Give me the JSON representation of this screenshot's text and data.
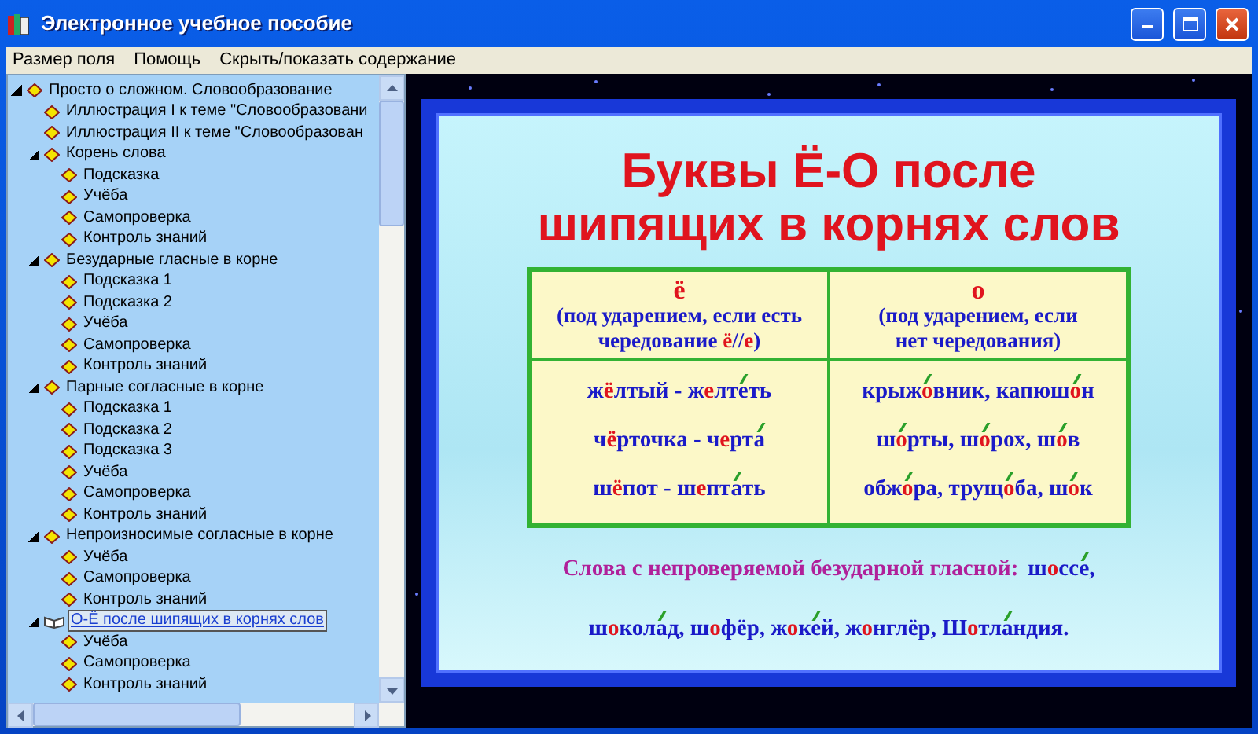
{
  "window": {
    "title": "Электронное учебное пособие"
  },
  "menu": [
    "Размер поля",
    "Помощь",
    "Скрыть/показать содержание"
  ],
  "tree": [
    {
      "label": "Просто о сложном. Словообразование",
      "expanded": true,
      "selected": false,
      "children": [
        {
          "label": "Иллюстрация I к теме \"Словообразовани",
          "selected": false
        },
        {
          "label": "Иллюстрация II к теме \"Словообразован",
          "selected": false
        },
        {
          "label": "Корень слова",
          "expanded": true,
          "selected": false,
          "children": [
            {
              "label": "Подсказка",
              "selected": false
            },
            {
              "label": "Учёба",
              "selected": false
            },
            {
              "label": "Самопроверка",
              "selected": false
            },
            {
              "label": "Контроль знаний",
              "selected": false
            }
          ]
        },
        {
          "label": "Безударные гласные в корне",
          "expanded": true,
          "selected": false,
          "children": [
            {
              "label": "Подсказка 1",
              "selected": false
            },
            {
              "label": "Подсказка 2",
              "selected": false
            },
            {
              "label": "Учёба",
              "selected": false
            },
            {
              "label": "Самопроверка",
              "selected": false
            },
            {
              "label": "Контроль знаний",
              "selected": false
            }
          ]
        },
        {
          "label": "Парные согласные в корне",
          "expanded": true,
          "selected": false,
          "children": [
            {
              "label": "Подсказка 1",
              "selected": false
            },
            {
              "label": "Подсказка 2",
              "selected": false
            },
            {
              "label": "Подсказка 3",
              "selected": false
            },
            {
              "label": "Учёба",
              "selected": false
            },
            {
              "label": "Самопроверка",
              "selected": false
            },
            {
              "label": "Контроль знаний",
              "selected": false
            }
          ]
        },
        {
          "label": "Непроизносимые согласные в корне",
          "expanded": true,
          "selected": false,
          "children": [
            {
              "label": "Учёба",
              "selected": false
            },
            {
              "label": "Самопроверка",
              "selected": false
            },
            {
              "label": "Контроль знаний",
              "selected": false
            }
          ]
        },
        {
          "label": "О-Ё после шипящих в корнях слов",
          "expanded": true,
          "selected": true,
          "children": [
            {
              "label": "Учёба",
              "selected": false
            },
            {
              "label": "Самопроверка",
              "selected": false
            },
            {
              "label": "Контроль знаний",
              "selected": false
            }
          ]
        }
      ]
    }
  ],
  "slide": {
    "title_lines": [
      "Буквы Ё-О после",
      "шипящих в корнях слов"
    ],
    "table": {
      "headers": [
        {
          "letter": "ё",
          "note_lines": [
            [
              {
                "text": "(под ударением, если есть",
                "kind": "plain"
              }
            ],
            [
              {
                "text": "чередование ",
                "kind": "plain"
              },
              {
                "text": "ё",
                "kind": "mark"
              },
              {
                "text": "//",
                "kind": "plain"
              },
              {
                "text": "е",
                "kind": "mark"
              },
              {
                "text": ")",
                "kind": "plain"
              }
            ]
          ]
        },
        {
          "letter": "о",
          "note_lines": [
            [
              {
                "text": "(под ударением, если",
                "kind": "plain"
              }
            ],
            [
              {
                "text": "нет чередования)",
                "kind": "plain"
              }
            ]
          ]
        }
      ],
      "columns": [
        [
          [
            {
              "text": "ж",
              "kind": "plain"
            },
            {
              "text": "ё",
              "kind": "mark"
            },
            {
              "text": "лтый - ж",
              "kind": "plain"
            },
            {
              "text": "е",
              "kind": "mark"
            },
            {
              "text": "лт",
              "kind": "plain"
            },
            {
              "text": "е",
              "kind": "stress"
            },
            {
              "text": "ть",
              "kind": "plain"
            }
          ],
          [
            {
              "text": "ч",
              "kind": "plain"
            },
            {
              "text": "ё",
              "kind": "mark"
            },
            {
              "text": "рточка - ч",
              "kind": "plain"
            },
            {
              "text": "е",
              "kind": "mark"
            },
            {
              "text": "рт",
              "kind": "plain"
            },
            {
              "text": "а",
              "kind": "stress"
            }
          ],
          [
            {
              "text": "ш",
              "kind": "plain"
            },
            {
              "text": "ё",
              "kind": "mark"
            },
            {
              "text": "пот - ш",
              "kind": "plain"
            },
            {
              "text": "е",
              "kind": "mark"
            },
            {
              "text": "пт",
              "kind": "plain"
            },
            {
              "text": "а",
              "kind": "stress"
            },
            {
              "text": "ть",
              "kind": "plain"
            }
          ]
        ],
        [
          [
            {
              "text": "крыж",
              "kind": "plain"
            },
            {
              "text": "о",
              "kind": "mark_stress"
            },
            {
              "text": "вник, капюш",
              "kind": "plain"
            },
            {
              "text": "о",
              "kind": "mark_stress"
            },
            {
              "text": "н",
              "kind": "plain"
            }
          ],
          [
            {
              "text": "ш",
              "kind": "plain"
            },
            {
              "text": "о",
              "kind": "mark_stress"
            },
            {
              "text": "рты, ш",
              "kind": "plain"
            },
            {
              "text": "о",
              "kind": "mark_stress"
            },
            {
              "text": "рох, ш",
              "kind": "plain"
            },
            {
              "text": "о",
              "kind": "mark_stress"
            },
            {
              "text": "в",
              "kind": "plain"
            }
          ],
          [
            {
              "text": "обж",
              "kind": "plain"
            },
            {
              "text": "о",
              "kind": "mark_stress"
            },
            {
              "text": "ра, трущ",
              "kind": "plain"
            },
            {
              "text": "о",
              "kind": "mark_stress"
            },
            {
              "text": "ба, ш",
              "kind": "plain"
            },
            {
              "text": "о",
              "kind": "mark_stress"
            },
            {
              "text": "к",
              "kind": "plain"
            }
          ]
        ]
      ]
    },
    "note_label": "Слова с непроверяемой безударной гласной:",
    "note_lines": [
      [
        {
          "text": "ш",
          "kind": "plain"
        },
        {
          "text": "о",
          "kind": "mark"
        },
        {
          "text": "сс",
          "kind": "plain"
        },
        {
          "text": "е",
          "kind": "stress"
        },
        {
          "text": ",",
          "kind": "plain"
        }
      ],
      [
        {
          "text": "ш",
          "kind": "plain"
        },
        {
          "text": "о",
          "kind": "mark"
        },
        {
          "text": "кол",
          "kind": "plain"
        },
        {
          "text": "а",
          "kind": "stress"
        },
        {
          "text": "д, ш",
          "kind": "plain"
        },
        {
          "text": "о",
          "kind": "mark"
        },
        {
          "text": "фёр, ж",
          "kind": "plain"
        },
        {
          "text": "о",
          "kind": "mark"
        },
        {
          "text": "к",
          "kind": "plain"
        },
        {
          "text": "е",
          "kind": "stress"
        },
        {
          "text": "й, ж",
          "kind": "plain"
        },
        {
          "text": "о",
          "kind": "mark"
        },
        {
          "text": "нглёр, Ш",
          "kind": "plain"
        },
        {
          "text": "о",
          "kind": "mark"
        },
        {
          "text": "тл",
          "kind": "plain"
        },
        {
          "text": "а",
          "kind": "stress"
        },
        {
          "text": "ндия.",
          "kind": "plain"
        }
      ]
    ]
  }
}
